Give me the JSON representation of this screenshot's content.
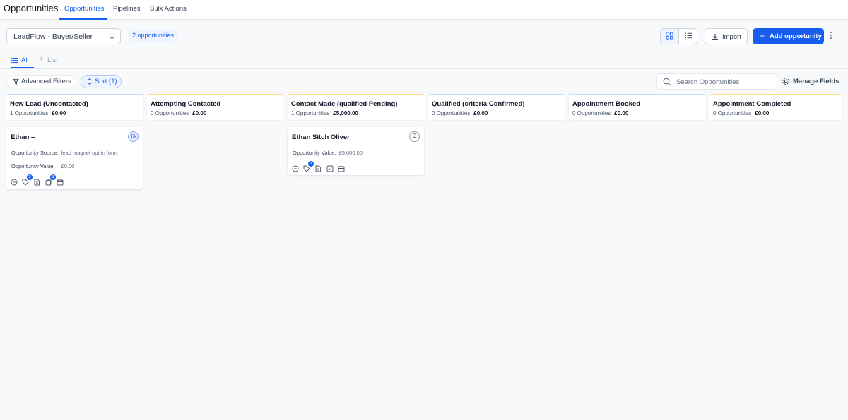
{
  "header": {
    "title": "Opportunities",
    "tabs": [
      {
        "label": "Opportunities",
        "active": true
      },
      {
        "label": "Pipelines",
        "active": false
      },
      {
        "label": "Bulk Actions",
        "active": false
      }
    ]
  },
  "toolbar": {
    "pipeline_select": "LeadFlow - Buyer/Seller",
    "count_badge": "2 opportunities",
    "import_label": "Import",
    "add_label": "Add opportunity"
  },
  "views": {
    "all_label": "All",
    "list_label": "List"
  },
  "filters": {
    "advanced_label": "Advanced Filters",
    "sort_label": "Sort (1)",
    "search_placeholder": "Search Opportunities",
    "manage_fields_label": "Manage Fields"
  },
  "stages": [
    {
      "name": "New Lead (Uncontacted)",
      "count": "1 Opportunities",
      "amount": "£0.00",
      "color": "#c7d7fe"
    },
    {
      "name": "Attempting Contacted",
      "count": "0 Opportunities",
      "amount": "£0.00",
      "color": "#fedf89"
    },
    {
      "name": "Contact Made (qualified Pending)",
      "count": "1 Opportunities",
      "amount": "£5,000.00",
      "color": "#fedf89"
    },
    {
      "name": "Qualified (criteria Confirmed)",
      "count": "0 Opportunities",
      "amount": "£0.00",
      "color": "#b9e6fe"
    },
    {
      "name": "Appointment Booked",
      "count": "0 Opportunities",
      "amount": "£0.00",
      "color": "#b9e6fe"
    },
    {
      "name": "Appointment Completed",
      "count": "0 Opportunities",
      "amount": "£0.00",
      "color": "#fedf89"
    }
  ],
  "cards": [
    {
      "title": "Ethan –",
      "avatar": "TA",
      "fields": [
        {
          "label": "Opportunity Source:",
          "value": "lead magnet opt-in form"
        },
        {
          "label": "Opportunity Value:",
          "value": "£0.00"
        }
      ],
      "badges": {
        "tag": "3",
        "tasks": "1"
      }
    },
    {
      "title": "Ethan Sitch Oliver",
      "avatar": "",
      "fields": [
        {
          "label": "Opportunity Value:",
          "value": "£5,000.00"
        }
      ],
      "badges": {
        "tag": "1"
      }
    }
  ],
  "colors": {
    "accent": "#155eef",
    "background": "#f8f9fb"
  }
}
